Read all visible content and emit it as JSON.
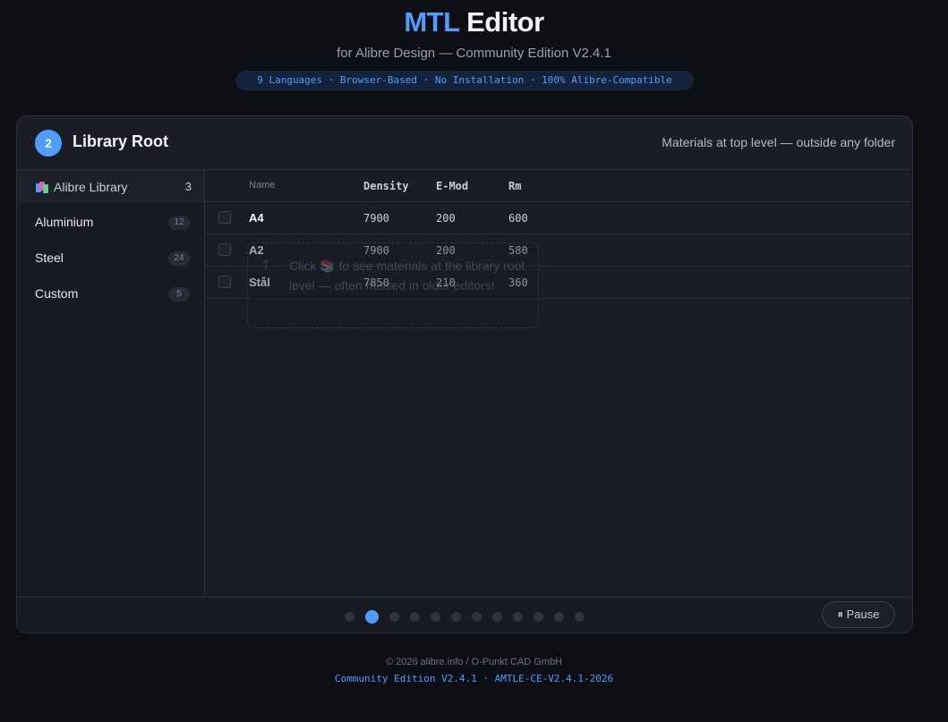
{
  "header": {
    "title_accent": "MTL",
    "title_rest": "Editor",
    "subtitle": "for Alibre Design — Community Edition V2.4.1",
    "tagline": "9 Languages · Browser-Based · No Installation · 100% Alibre-Compatible"
  },
  "panel": {
    "step": "2",
    "title": "Library Root",
    "description": "Materials at top level — outside any folder"
  },
  "sidebar": {
    "root": {
      "label": "Alibre Library",
      "count": "3",
      "icon": "library-books-icon"
    },
    "items": [
      {
        "label": "Aluminium",
        "count": "12"
      },
      {
        "label": "Steel",
        "count": "24"
      },
      {
        "label": "Custom",
        "count": "5"
      }
    ]
  },
  "table": {
    "headers": {
      "name": "Name",
      "density": "Density",
      "emod": "E-Mod",
      "rm": "Rm"
    },
    "rows": [
      {
        "name": "A4",
        "density": "7900",
        "emod": "200",
        "rm": "600"
      },
      {
        "name": "A2",
        "density": "7900",
        "emod": "200",
        "rm": "580"
      },
      {
        "name": "Stål",
        "density": "7850",
        "emod": "210",
        "rm": "360"
      }
    ]
  },
  "hint": {
    "icon": "arrow-up-icon",
    "text": "Click 📚 to see materials at the library root level — often missed in older editors!"
  },
  "carousel": {
    "total_steps": 12,
    "active_index": 1
  },
  "controls": {
    "pause_label": "⏸ Pause"
  },
  "footer": {
    "copyright": "© 2026 alibre.info / O-Punkt CAD GmbH",
    "edition": "Community Edition V2.4.1 · AMTLE-CE-V2.4.1-2026"
  },
  "colors": {
    "accent": "#4f9dff",
    "background": "#0d0f14",
    "panel": "#171a21"
  }
}
